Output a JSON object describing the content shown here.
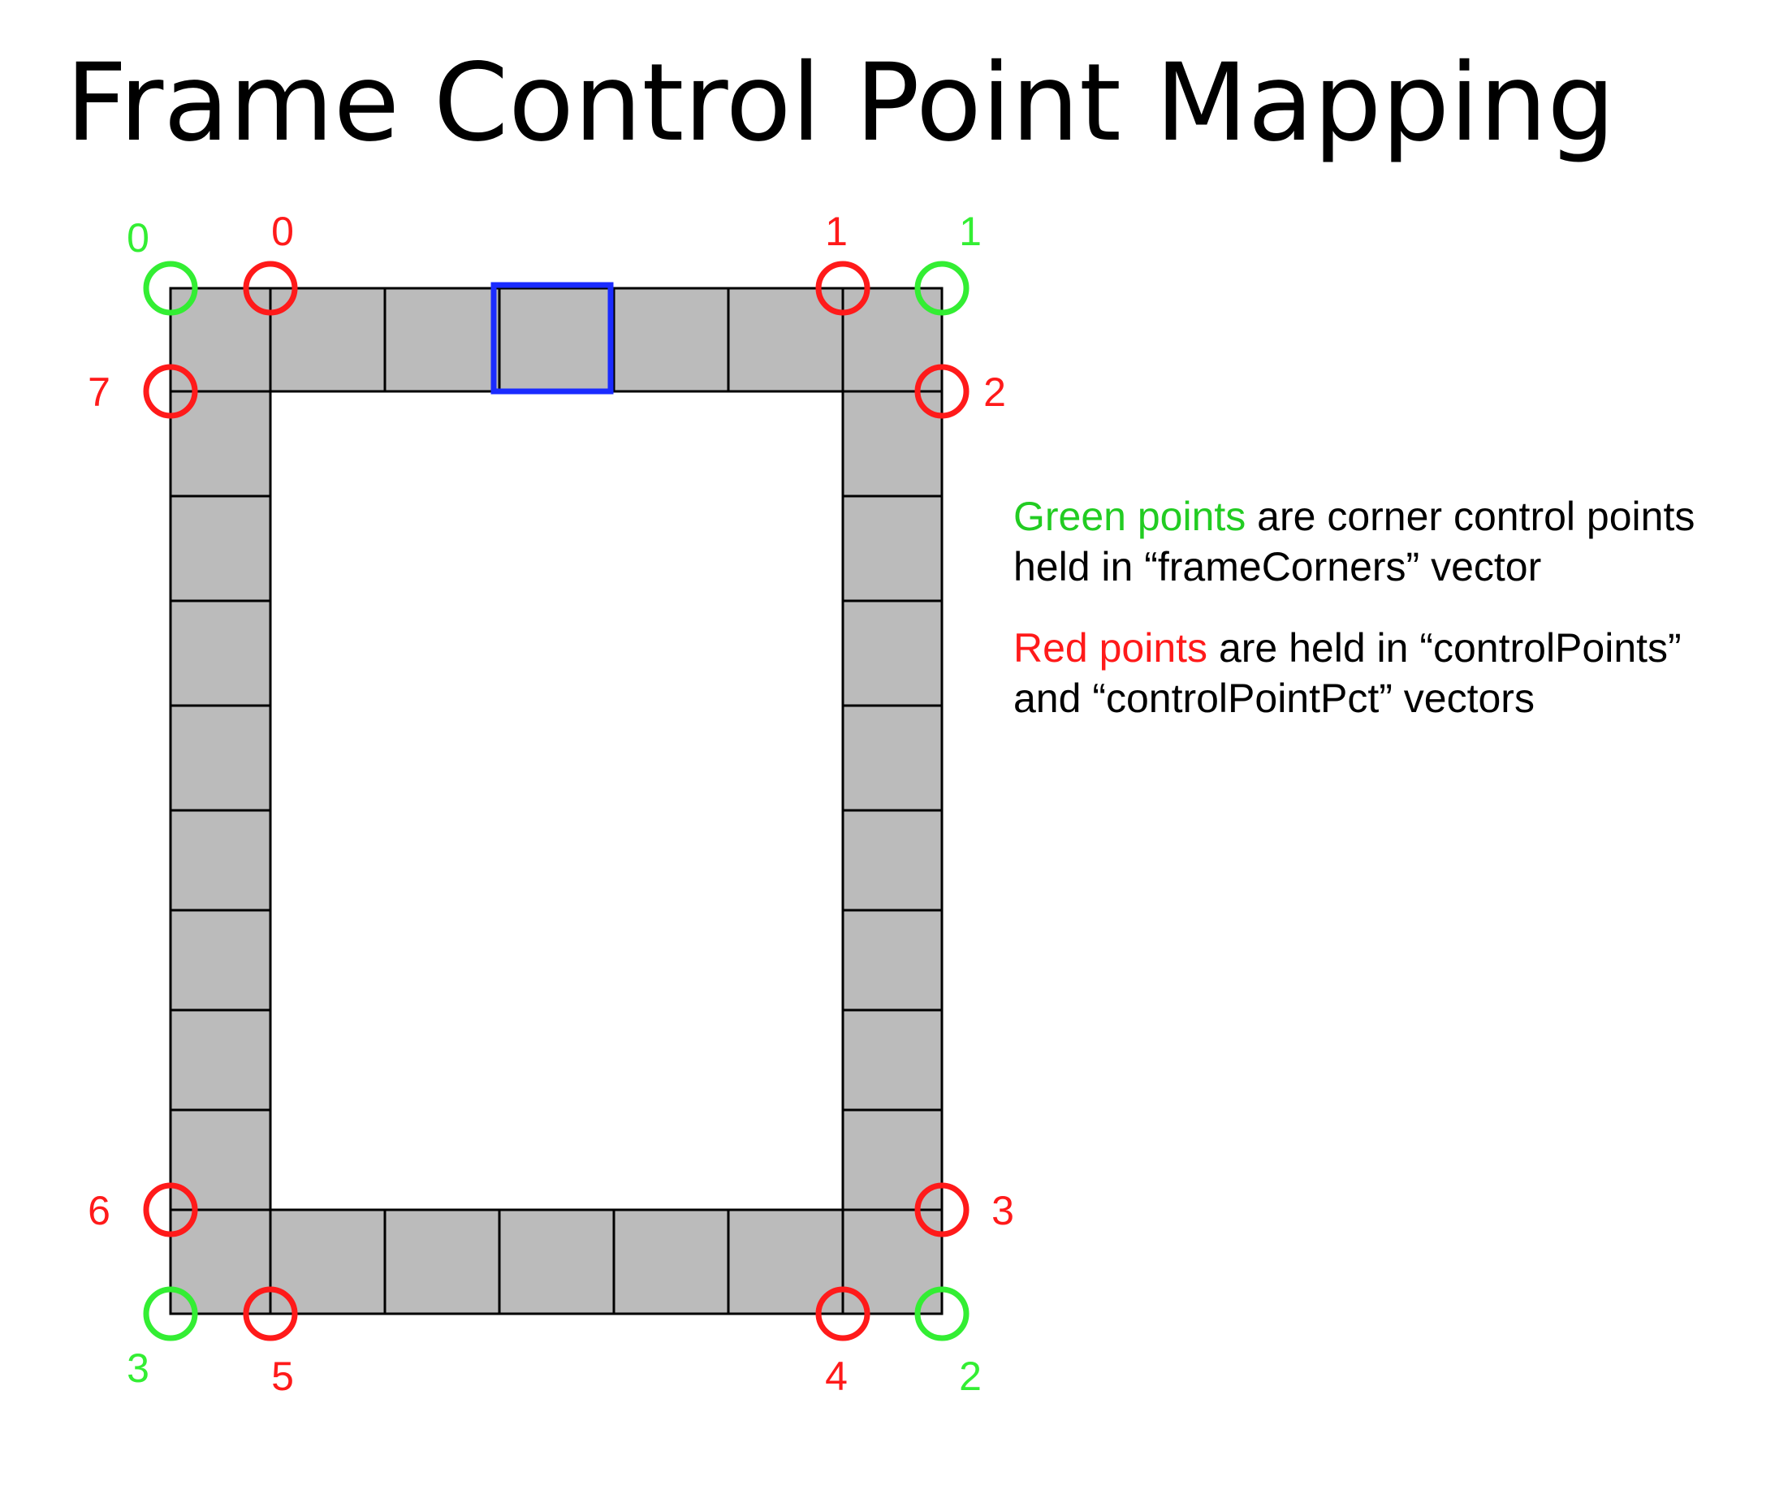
{
  "title": "Frame Control Point Mapping",
  "colors": {
    "green": "#33ee33",
    "green_text": "#22cc22",
    "red": "#ff1a1a",
    "blue": "#1a2bff",
    "tile_fill": "#bbbbbb",
    "grid_line": "#000000"
  },
  "frame_corners": {
    "description": "green corner control points",
    "labels": [
      "0",
      "1",
      "2",
      "3"
    ]
  },
  "control_points": {
    "description": "red control points",
    "labels": [
      "0",
      "1",
      "2",
      "3",
      "4",
      "5",
      "6",
      "7"
    ]
  },
  "legend": {
    "green_highlight": "Green points",
    "green_rest": " are corner control points held in “frameCorners” vector",
    "red_highlight": "Red points",
    "red_rest": " are held in “controlPoints” and “controlPointPct” vectors"
  }
}
